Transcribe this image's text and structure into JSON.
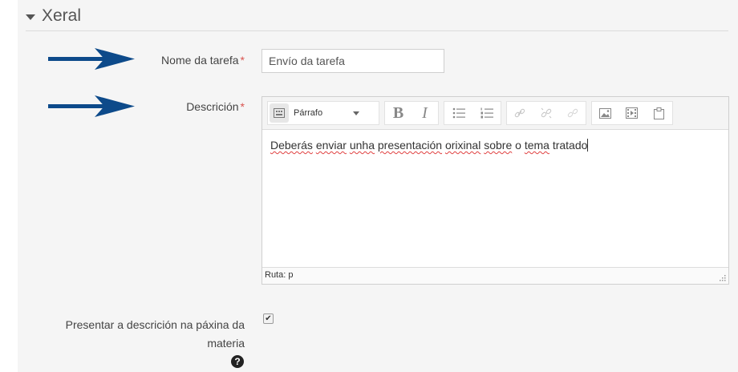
{
  "section": {
    "title": "Xeral"
  },
  "fields": {
    "task_name": {
      "label": "Nome da tarefa",
      "required_mark": "*",
      "value": "Envío da  tarefa"
    },
    "description": {
      "label": "Descrición",
      "required_mark": "*",
      "format_select": "Párrafo",
      "content_words": [
        "Deberás",
        " ",
        "enviar",
        " ",
        "unha",
        " ",
        "presentación",
        " ",
        "orixinal",
        " ",
        "sobre",
        " o ",
        "tema",
        " tratado"
      ],
      "path_label": "Ruta: p"
    },
    "show_description": {
      "label_line1": "Presentar a descrición na páxina da",
      "label_line2": "materia",
      "checked": true,
      "checkmark": "✔",
      "help_glyph": "?"
    }
  },
  "toolbar": {
    "bold": "B",
    "italic": "I",
    "icons": [
      "keyboard-icon",
      "bullet-list-icon",
      "numbered-list-icon",
      "link-icon",
      "unlink-icon",
      "anchor-icon",
      "image-icon",
      "media-icon",
      "paste-icon"
    ]
  },
  "colors": {
    "arrow": "#0d4a8a",
    "required": "#d9534f",
    "spellcheck": "#e04040"
  }
}
